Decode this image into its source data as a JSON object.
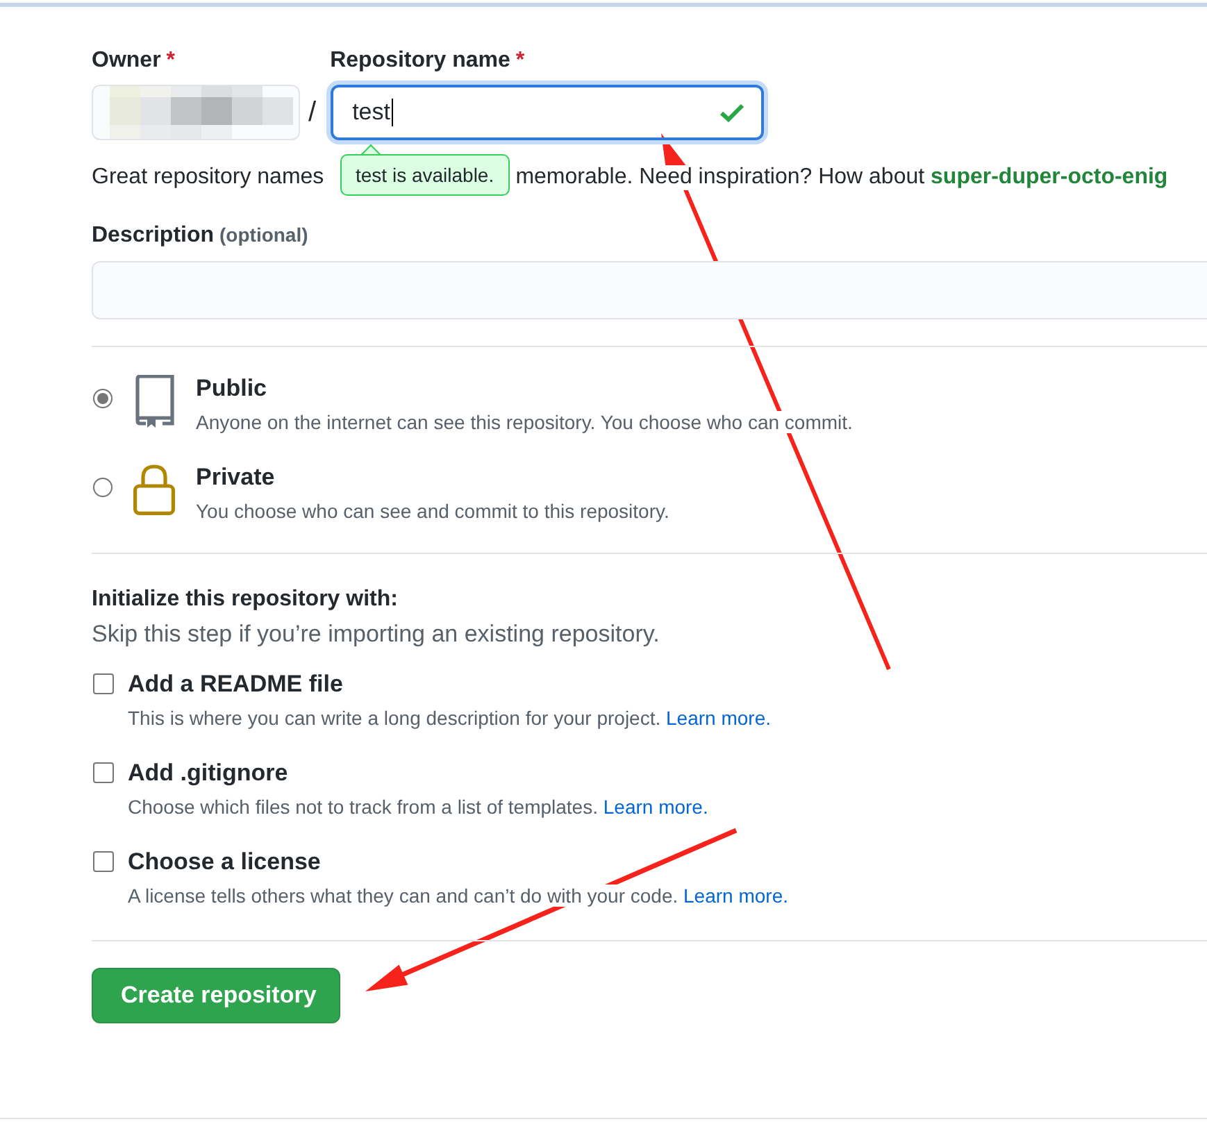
{
  "owner": {
    "label": "Owner",
    "required_mark": "*",
    "separator": "/"
  },
  "repo_name": {
    "label": "Repository name",
    "required_mark": "*",
    "value": "test",
    "valid": true,
    "tooltip": "test is available."
  },
  "hint": {
    "before": "Great repository names",
    "after": "memorable. Need inspiration? How about ",
    "suggestion": "super-duper-octo-enig"
  },
  "description": {
    "label": "Description",
    "optional": "(optional)"
  },
  "visibility": [
    {
      "kind": "public",
      "title": "Public",
      "description": "Anyone on the internet can see this repository. You choose who can commit.",
      "selected": true
    },
    {
      "kind": "private",
      "title": "Private",
      "description": "You choose who can see and commit to this repository.",
      "selected": false
    }
  ],
  "init": {
    "title": "Initialize this repository with:",
    "subtitle": "Skip this step if you’re importing an existing repository.",
    "options": [
      {
        "label": "Add a README file",
        "description": "This is where you can write a long description for your project.",
        "link": "Learn more.",
        "checked": false
      },
      {
        "label": "Add .gitignore",
        "description": "Choose which files not to track from a list of templates.",
        "link": "Learn more.",
        "checked": false
      },
      {
        "label": "Choose a license",
        "description": "A license tells others what they can and can’t do with your code.",
        "link": "Learn more.",
        "checked": false
      }
    ]
  },
  "submit": "Create repository"
}
